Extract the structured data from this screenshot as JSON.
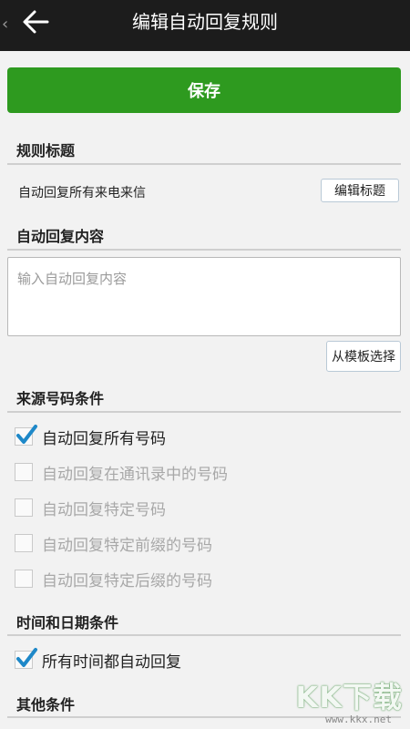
{
  "header": {
    "title": "编辑自动回复规则",
    "back_icon": "arrow-left-icon",
    "chevron_icon": "chevron-left-icon"
  },
  "save_button": {
    "label": "保存",
    "color": "#2e9a1f"
  },
  "rule_title_section": {
    "heading": "规则标题",
    "value": "自动回复所有来电来信",
    "edit_button": "编辑标题"
  },
  "reply_content_section": {
    "heading": "自动回复内容",
    "placeholder": "输入自动回复内容",
    "template_button": "从模板选择"
  },
  "source_number_section": {
    "heading": "来源号码条件",
    "options": [
      {
        "label": "自动回复所有号码",
        "checked": true,
        "enabled": true
      },
      {
        "label": "自动回复在通讯录中的号码",
        "checked": false,
        "enabled": false
      },
      {
        "label": "自动回复特定号码",
        "checked": false,
        "enabled": false
      },
      {
        "label": "自动回复特定前缀的号码",
        "checked": false,
        "enabled": false
      },
      {
        "label": "自动回复特定后缀的号码",
        "checked": false,
        "enabled": false
      }
    ]
  },
  "time_date_section": {
    "heading": "时间和日期条件",
    "options": [
      {
        "label": "所有时间都自动回复",
        "checked": true,
        "enabled": true
      }
    ]
  },
  "other_section": {
    "heading": "其他条件"
  },
  "watermark": {
    "big": "KK下载",
    "small": "www.kkx.net"
  },
  "colors": {
    "accent": "#2e9a1f",
    "check": "#1e88c8",
    "appbar": "#1c1c1c"
  }
}
